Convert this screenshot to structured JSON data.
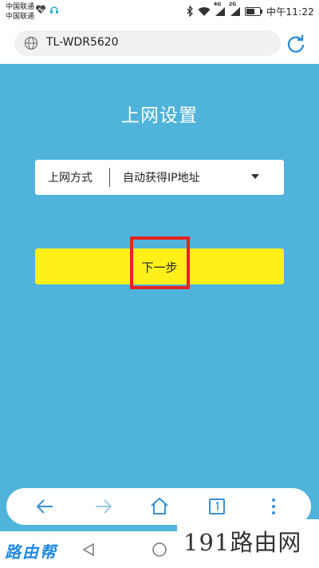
{
  "status_bar": {
    "carrier_1": "中国联通",
    "carrier_2": "中国联通",
    "network_1": "4G",
    "network_2": "2G",
    "time": "中午11:22"
  },
  "browser": {
    "url": "TL-WDR5620"
  },
  "page": {
    "title": "上网设置",
    "connection_label": "上网方式",
    "connection_value": "自动获得IP地址",
    "next_button": "下一步"
  },
  "watermarks": {
    "left": "路由帮",
    "right": "191路由网"
  },
  "colors": {
    "background": "#4fb3db",
    "button": "#fff01a",
    "highlight": "#e52421",
    "nav_accent": "#3a8fd6"
  },
  "icons": {
    "back": "arrow-left-icon",
    "forward": "arrow-right-icon",
    "home": "home-icon",
    "tabs": "tabs-icon",
    "menu": "more-vertical-icon"
  }
}
